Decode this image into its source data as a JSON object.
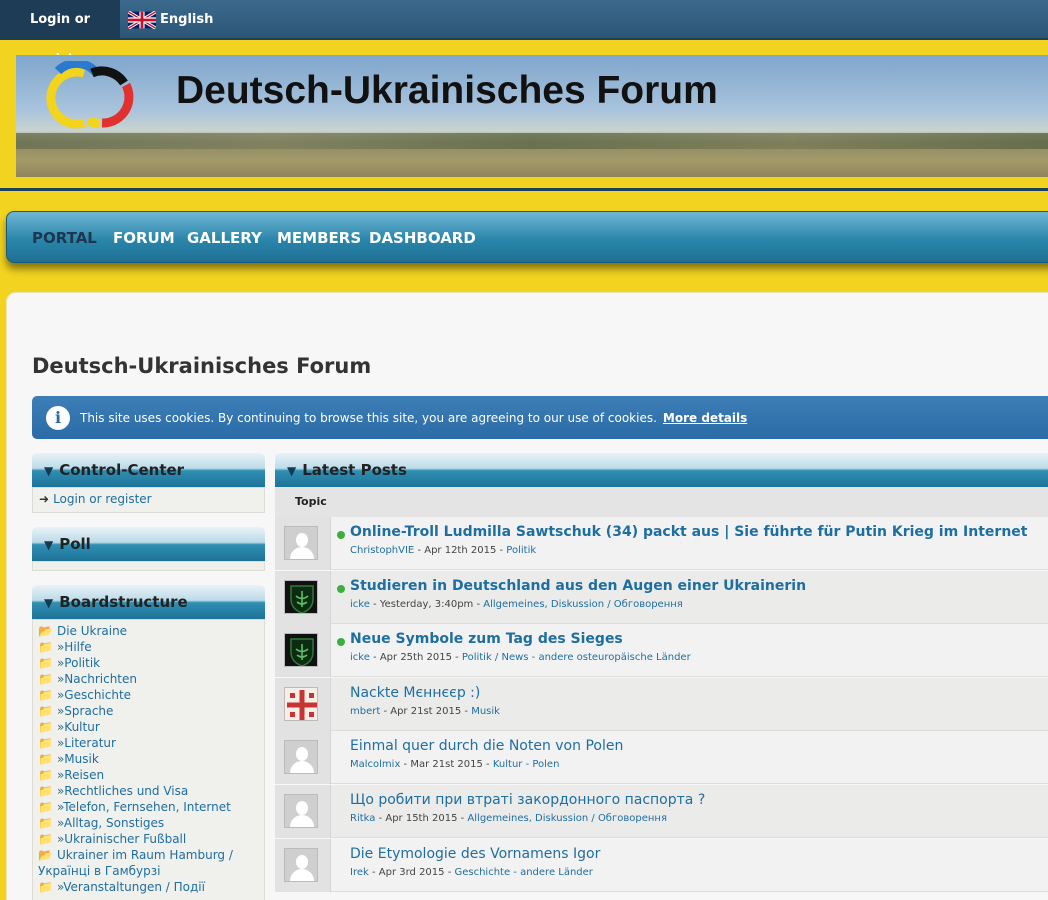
{
  "topbar": {
    "login_label": "Login or register",
    "language_label": "English"
  },
  "banner": {
    "title": "Deutsch-Ukrainisches Forum"
  },
  "nav": {
    "items": [
      "PORTAL",
      "FORUM",
      "GALLERY",
      "MEMBERS",
      "DASHBOARD"
    ],
    "active": "PORTAL"
  },
  "page": {
    "title": "Deutsch-Ukrainisches Forum"
  },
  "cookie_notice": {
    "text": "This site uses cookies. By continuing to browse this site, you are agreeing to our use of cookies.",
    "link": "More details"
  },
  "sidebar": {
    "control_center": {
      "title": "Control-Center",
      "login_link": "Login or register"
    },
    "poll": {
      "title": "Poll"
    },
    "boardstructure": {
      "title": "Boardstructure",
      "items": [
        "Die Ukraine",
        "»Hilfe",
        "»Politik",
        "»Nachrichten",
        "»Geschichte",
        "»Sprache",
        "»Kultur",
        "»Literatur",
        "»Musik",
        "»Reisen",
        "»Rechtliches und Visa",
        "»Telefon, Fernsehen, Internet",
        "»Alltag, Sonstiges",
        "»Ukrainischer Fußball",
        "Ukrainer im Raum Hamburg /",
        "Українці в Гамбурзі",
        "»Veranstaltungen / Події"
      ]
    }
  },
  "latest_posts": {
    "title": "Latest Posts",
    "column_header": "Topic",
    "posts": [
      {
        "title": "Online-Troll Ludmilla Sawtschuk (34) packt aus | Sie führte für Putin Krieg im Internet",
        "user": "ChristophVIE",
        "date": " - Apr 12th 2015 - ",
        "category": "Politik",
        "online": true,
        "avatar": "default-avatar-icon"
      },
      {
        "title": "Studieren in Deutschland aus den Augen einer Ukrainerin",
        "user": "icke",
        "date": " - Yesterday, 3:40pm - ",
        "category": "Allgemeines, Diskussion / Обговорення",
        "online": true,
        "avatar": "emblem-avatar-icon"
      },
      {
        "title": "Neue Symbole zum Tag des Sieges",
        "user": "icke",
        "date": " - Apr 25th 2015 - ",
        "category": "Politik / News - andere osteuropäische Länder",
        "online": true,
        "avatar": "emblem-avatar-icon"
      },
      {
        "title": "Nackte Мєннєєр :)",
        "user": "mbert",
        "date": " - Apr 21st 2015 - ",
        "category": "Musik",
        "online": false,
        "avatar": "flag-avatar-icon"
      },
      {
        "title": "Einmal quer durch die Noten von Polen",
        "user": "Malcolmix",
        "date": " - Mar 21st 2015 - ",
        "category": "Kultur - Polen",
        "online": false,
        "avatar": "default-avatar-icon"
      },
      {
        "title": "Що робити при втраті закордонного паспорта ?",
        "user": "Ritka",
        "date": " - Apr 15th 2015 - ",
        "category": "Allgemeines, Diskussion / Обговорення",
        "online": false,
        "avatar": "default-avatar-icon"
      },
      {
        "title": "Die Etymologie des Vornamens Igor",
        "user": "Irek",
        "date": " - Apr 3rd 2015 - ",
        "category": "Geschichte - andere Länder",
        "online": false,
        "avatar": "default-avatar-icon"
      }
    ]
  },
  "colors": {
    "page_background": "#f2d31f",
    "topbar": "#2c5676",
    "nav": "#2a86ab",
    "link": "#1f6ea0",
    "cookie_bar": "#2a6aa6",
    "online_dot": "#3dae3d"
  }
}
